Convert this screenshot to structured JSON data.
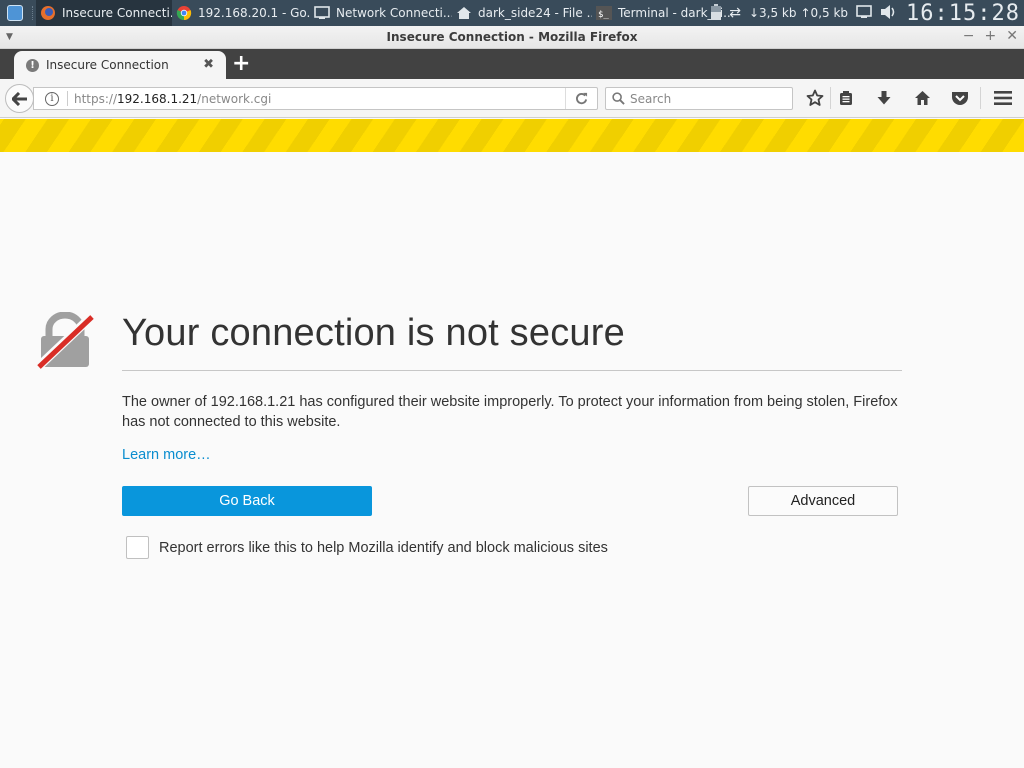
{
  "taskbar": {
    "tasks": [
      {
        "label": "Insecure Connecti...",
        "icon": "firefox-icon",
        "active": true
      },
      {
        "label": "192.168.20.1 - Go...",
        "icon": "chrome-icon",
        "active": false
      },
      {
        "label": "Network Connecti...",
        "icon": "monitor-icon",
        "active": false
      },
      {
        "label": "dark_side24 - File ...",
        "icon": "home-folder-icon",
        "active": false
      },
      {
        "label": "Terminal - dark_si...",
        "icon": "terminal-icon",
        "active": false
      }
    ],
    "tray": {
      "network_down": "↓3,5 kb",
      "network_up": "↑0,5 kb",
      "clock": "16:15:28"
    }
  },
  "window": {
    "title": "Insecure Connection - Mozilla Firefox",
    "minimize": "−",
    "maximize": "+",
    "close": "✕"
  },
  "tabs": [
    {
      "label": "Insecure Connection",
      "icon": "warning-icon",
      "active": true
    }
  ],
  "new_tab_label": "+",
  "navbar": {
    "url_scheme": "https://",
    "url_host": "192.168.1.21",
    "url_path": "/network.cgi",
    "search_placeholder": "Search"
  },
  "page": {
    "title": "Your connection is not secure",
    "description": "The owner of 192.168.1.21 has configured their website improperly. To protect your information from being stolen, Firefox has not connected to this website.",
    "learn_more": "Learn more…",
    "go_back": "Go Back",
    "advanced": "Advanced",
    "report_label": "Report errors like this to help Mozilla identify and block malicious sites",
    "report_checked": false
  },
  "colors": {
    "accent_blue": "#0996dc",
    "link_blue": "#0a8dcf",
    "warning_yellow": "#ffdc00",
    "lock_strike_red": "#d92d26"
  }
}
